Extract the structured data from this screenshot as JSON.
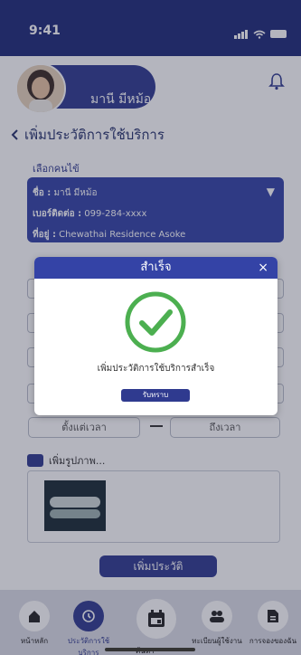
{
  "status_bar": {
    "time": "9:41"
  },
  "header": {
    "user_name": "มานี มีหม้อ"
  },
  "page": {
    "title": "เพิ่มประวัติการใช้บริการ",
    "select_label": "เลือกคนไข้"
  },
  "patient_card": {
    "name_label": "ชื่อ :",
    "name_value": " มานี มีหม้อ",
    "phone_label": "เบอร์ติดต่อ :",
    "phone_value": " 099-284-xxxx",
    "address_label": "ที่อยู่ :",
    "address_value": " Chewathai Residence Asoke"
  },
  "form": {
    "time_from": "ตั้งแต่เวลา",
    "time_to": "ถึงเวลา",
    "add_photo": "เพิ่มรูปภาพ...",
    "submit": "เพิ่มประวัติ"
  },
  "modal": {
    "title": "สำเร็จ",
    "close": "×",
    "message": "เพิ่มประวัติการใช้บริการสำเร็จ",
    "ok": "รับทราบ"
  },
  "nav": {
    "home": "หน้าหลัก",
    "history": "ประวัติการใช้บริการ",
    "search": "ค้นหา",
    "users": "ทะเบียนผู้ใช้งาน",
    "bookings": "การจองของฉัน"
  },
  "colors": {
    "primary": "#2f3a8f",
    "success": "#4caf50"
  }
}
